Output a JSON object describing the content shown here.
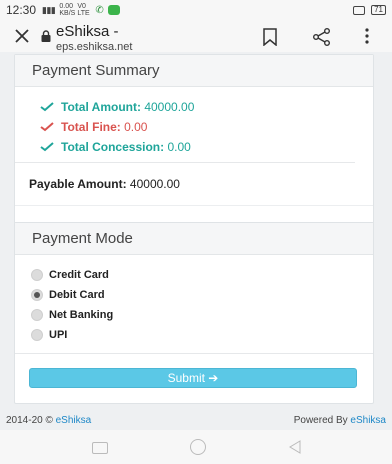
{
  "status_bar": {
    "time": "12:30",
    "signal": "ᵕ•••",
    "network_top": "0.00",
    "network_bottom": "KB/S",
    "network_top2": "V0",
    "network_bottom2": "LTE",
    "battery": "71"
  },
  "browser": {
    "title": "eShiksa -",
    "url": "eps.eshiksa.net"
  },
  "summary": {
    "heading": "Payment Summary",
    "rows": [
      {
        "label": "Total Amount:",
        "value": "40000.00",
        "color": "#1fa59a"
      },
      {
        "label": "Total Fine:",
        "value": "0.00",
        "color": "#d9534f"
      },
      {
        "label": "Total Concession:",
        "value": "0.00",
        "color": "#1fa59a"
      }
    ],
    "payable_label": "Payable Amount:",
    "payable_value": "40000.00"
  },
  "mode": {
    "heading": "Payment Mode",
    "options": [
      {
        "label": "Credit Card",
        "checked": false
      },
      {
        "label": "Debit Card",
        "checked": true
      },
      {
        "label": "Net Banking",
        "checked": false
      },
      {
        "label": "UPI",
        "checked": false
      }
    ],
    "submit_label": "Submit ➔"
  },
  "footer": {
    "left_text": "2014-20 © ",
    "left_link": "eShiksa",
    "right_text": "Powered By ",
    "right_link": "eShiksa"
  },
  "colors": {
    "accent": "#5bc8e6",
    "green": "#1fa59a",
    "red": "#d9534f",
    "link": "#1e88c7"
  }
}
